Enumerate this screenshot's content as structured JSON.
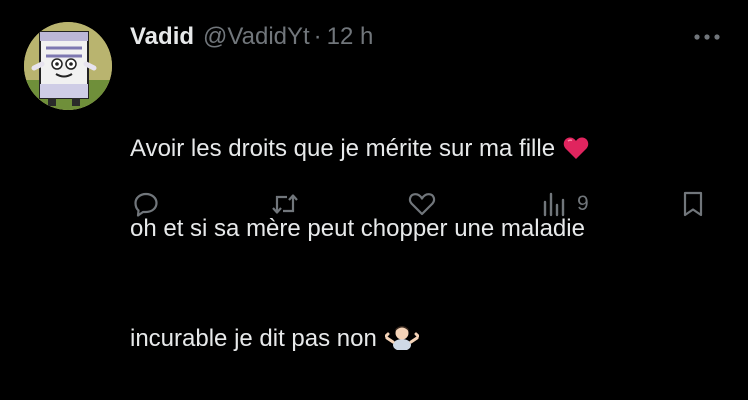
{
  "tweet": {
    "display_name": "Vadid",
    "handle": "@VadidYt",
    "separator": "·",
    "time": "12 h",
    "text_lines": [
      "Avoir les droits que je mérite sur ma fille",
      "oh et si sa mère peut chopper une maladie",
      "incurable je dit pas non"
    ],
    "inline_emojis": [
      "red-heart-emoji",
      "person-shrugging-emoji"
    ],
    "views_count": "9"
  },
  "actions": {
    "icons": [
      "reply-icon",
      "retweet-icon",
      "like-icon",
      "views-icon",
      "bookmark-icon"
    ]
  },
  "colors": {
    "background": "#000000",
    "text_primary": "#e7e9ea",
    "text_secondary": "#71767b",
    "heart": "#e0245e"
  }
}
